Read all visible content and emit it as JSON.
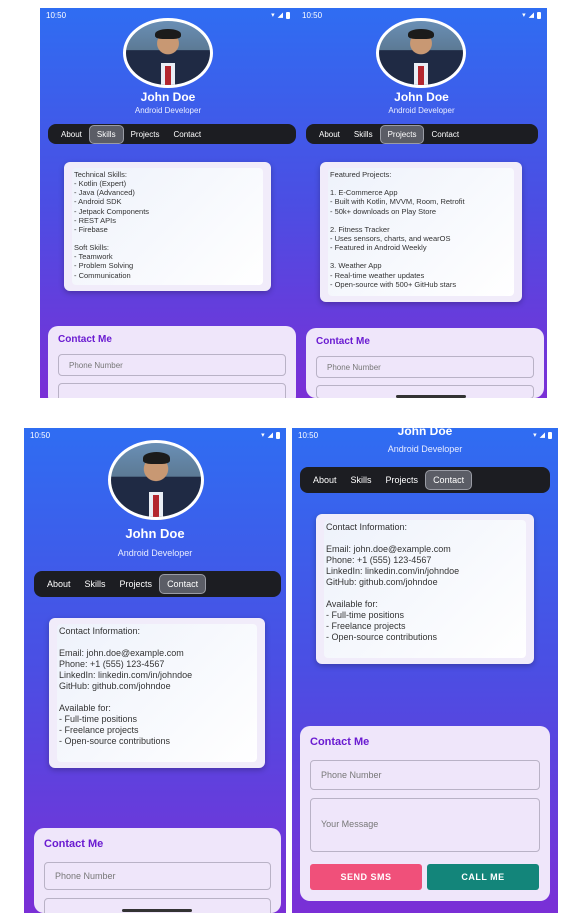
{
  "status": {
    "time": "10:50",
    "icons": [
      "settings-icon",
      "info-icon",
      "blocked-icon",
      "bug-icon",
      "dot-icon"
    ]
  },
  "profile": {
    "name": "John Doe",
    "role": "Android Developer"
  },
  "tabs": [
    "About",
    "Skills",
    "Projects",
    "Contact"
  ],
  "skills_card": "Technical Skills:\n- Kotlin (Expert)\n- Java (Advanced)\n- Android SDK\n- Jetpack Components\n- REST APIs\n- Firebase\n\nSoft Skills:\n- Teamwork\n- Problem Solving\n- Communication",
  "projects_card": "Featured Projects:\n\n1. E-Commerce App\n- Built with Kotlin, MVVM, Room, Retrofit\n- 50k+ downloads on Play Store\n\n2. Fitness Tracker\n- Uses sensors, charts, and wearOS\n- Featured in Android Weekly\n\n3. Weather App\n- Real-time weather updates\n- Open-source with 500+ GitHub stars",
  "contact_card": "Contact Information:\n\nEmail: john.doe@example.com\nPhone: +1 (555) 123-4567\nLinkedIn: linkedin.com/in/johndoe\nGitHub: github.com/johndoe\n\nAvailable for:\n- Full-time positions\n- Freelance projects\n- Open-source contributions",
  "contact_form": {
    "title": "Contact Me",
    "phone_placeholder": "Phone Number",
    "message_placeholder": "Your Message",
    "send_label": "SEND SMS",
    "call_label": "CALL ME"
  },
  "colors": {
    "send": "#f0507a",
    "call": "#13857a",
    "title": "#6a1bd1"
  }
}
